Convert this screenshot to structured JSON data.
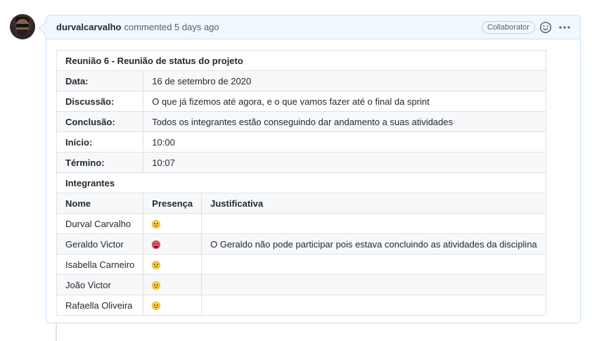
{
  "comment": {
    "author": "durvalcarvalho",
    "action": "commented 5 days ago",
    "badge": "Collaborator"
  },
  "table": {
    "title": "Reunião 6 - Reunião de status do projeto",
    "fields": [
      {
        "label": "Data:",
        "value": "16 de setembro de 2020"
      },
      {
        "label": "Discussão:",
        "value": "O que já fizemos até agora, e o que vamos fazer até o final da sprint"
      },
      {
        "label": "Conclusão:",
        "value": "Todos os integrantes estão conseguindo dar andamento a suas atividades"
      },
      {
        "label": "Início:",
        "value": "10:00"
      },
      {
        "label": "Término:",
        "value": "10:07"
      }
    ],
    "section": "Integrantes",
    "columns": [
      "Nome",
      "Presença",
      "Justificativa"
    ],
    "members": [
      {
        "name": "Durval Carvalho",
        "presence": "smile-emoji",
        "justification": ""
      },
      {
        "name": "Geraldo Victor",
        "presence": "angry-emoji",
        "justification": "O Geraldo não pode participar pois estava concluindo as atividades da disciplina"
      },
      {
        "name": "Isabella Carneiro",
        "presence": "smile-emoji",
        "justification": ""
      },
      {
        "name": "João Victor",
        "presence": "smile-emoji",
        "justification": ""
      },
      {
        "name": "Rafaella Oliveira",
        "presence": "smile-emoji",
        "justification": ""
      }
    ]
  },
  "icons": {
    "react": "smiley-icon",
    "more": "kebab-horizontal-icon"
  },
  "colors": {
    "header_bg": "#f1f8ff",
    "border": "#c8e1ff",
    "text": "#24292e",
    "muted": "#586069"
  }
}
